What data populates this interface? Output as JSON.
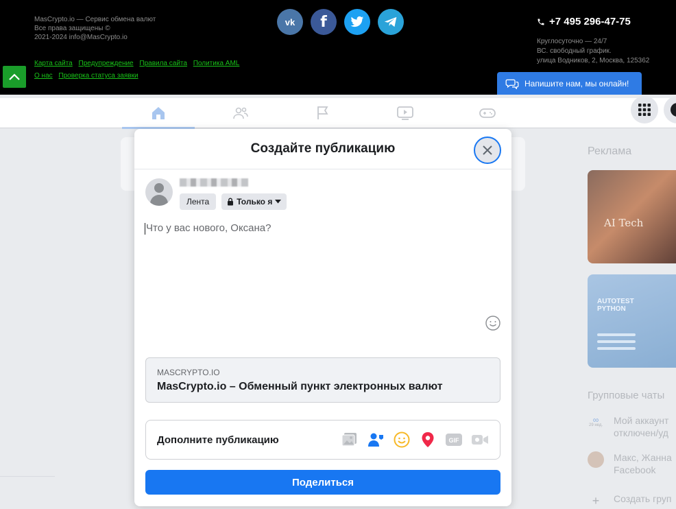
{
  "site_footer": {
    "line1": "MasCrypto.io — Сервис обмена валют",
    "line2": "Все права защищены ©",
    "line3": "2021-2024 info@MasCrypto.io",
    "links_row1": [
      "Карта сайта",
      "Предупреждение",
      "Правила сайта",
      "Политика AML"
    ],
    "links_row2": [
      "О нас",
      "Проверка статуса заявки"
    ],
    "socials": [
      "vk-icon",
      "facebook-icon",
      "twitter-icon",
      "telegram-icon"
    ],
    "vk_label": "vk",
    "fb_label": "f",
    "phone": "+7 495 296-47-75",
    "hours": "Круглосуточно — 24/7",
    "schedule": "ВС. свободный график.",
    "address": "улица Водников, 2, Москва, 125362",
    "chat_label": "Напишите нам, мы онлайн!"
  },
  "facebook": {
    "nav_tabs": [
      "home-icon",
      "friends-icon",
      "pages-icon",
      "watch-icon",
      "gaming-icon"
    ],
    "sidebar": {
      "ads_title": "Реклама",
      "ad1_text": "AI Tech",
      "ad2_text_l1": "AUTOTEST",
      "ad2_text_l2": "PYTHON",
      "group_chats_title": "Групповые чаты",
      "row1_l1": "Мой аккаунт",
      "row1_l2": "отключен/уд",
      "row1_badge": "29 нед.",
      "row2_l1": "Макс, Жанна",
      "row2_l2": "Facebook",
      "row3": "Создать груп"
    },
    "modal": {
      "title": "Создайте публикацию",
      "audience_feed": "Лента",
      "audience_privacy": "Только я",
      "composer_placeholder": "Что у вас нового, Оксана?",
      "link_preview_domain": "MASCRYPTO.IO",
      "link_preview_title": "MasCrypto.io – Обменный пункт электронных валют",
      "add_to_post": "Дополните публикацию",
      "share_button": "Поделиться"
    }
  }
}
